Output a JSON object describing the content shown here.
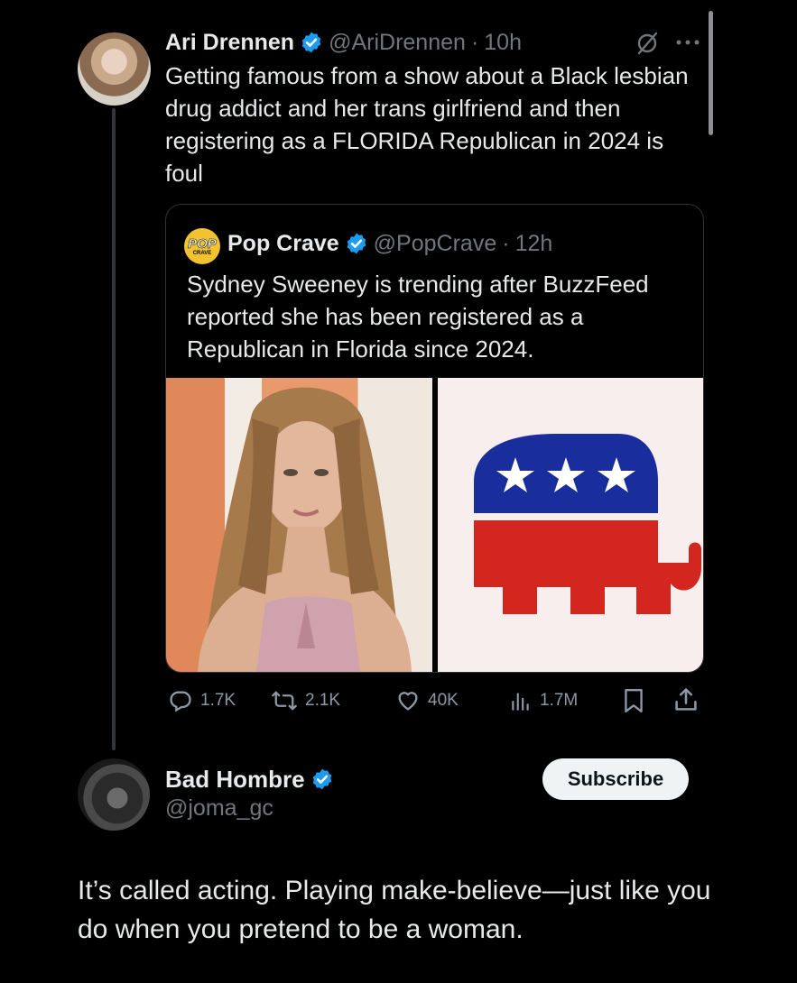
{
  "scroll_thumb": "scrollbar-thumb",
  "main_tweet": {
    "author_name": "Ari Drennen",
    "handle": "@AriDrennen",
    "separator": "·",
    "time": "10h",
    "text": "Getting famous from a show about a Black lesbian drug addict and her trans girlfriend and then registering as a FLORIDA Republican in 2024 is foul",
    "icons": {
      "grok": "slashed-circle-icon",
      "more": "more-dots-icon"
    }
  },
  "quote_tweet": {
    "logo_text_top": "POP",
    "logo_text_bottom": "CRAVE",
    "author_name": "Pop Crave",
    "handle": "@PopCrave",
    "separator": "·",
    "time": "12h",
    "text": "Sydney Sweeney is trending after BuzzFeed reported she has been registered as a Republican in Florida since 2024.",
    "images": [
      "photo-of-woman",
      "republican-elephant-logo"
    ]
  },
  "actions": {
    "replies": "1.7K",
    "reposts": "2.1K",
    "likes": "40K",
    "views": "1.7M"
  },
  "reply_author": {
    "author_name": "Bad Hombre",
    "handle": "@joma_gc",
    "subscribe_label": "Subscribe"
  },
  "reply_text": "It’s called acting. Playing make-believe—just like you do when you pretend to be a woman.",
  "colors": {
    "background": "#000000",
    "text": "#e7e9ea",
    "muted": "#71767b",
    "verified": "#1d9bf0",
    "gop_blue": "#1a2d9c",
    "gop_red": "#d2261f"
  }
}
